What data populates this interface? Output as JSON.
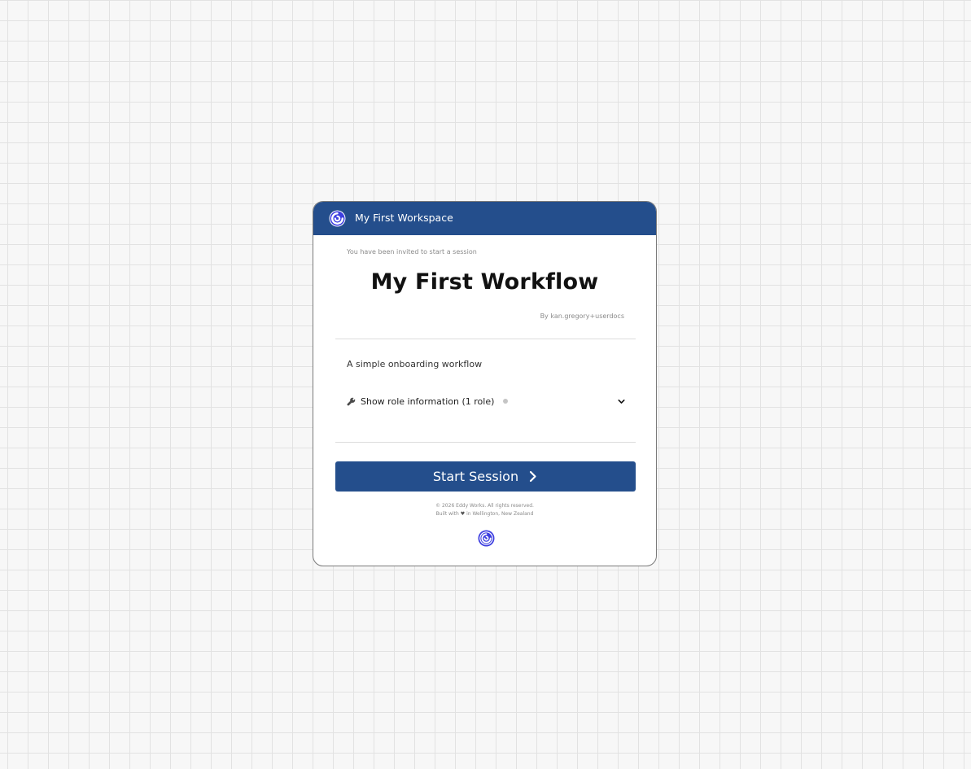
{
  "header": {
    "workspace_name": "My First Workspace",
    "logo_icon": "swirl-logo-icon"
  },
  "main": {
    "invite_text": "You have been invited to start a session",
    "title": "My First Workflow",
    "author": "By kan.gregory+userdocs",
    "description": "A simple onboarding workflow",
    "role_toggle_label": "Show role information (1 role)",
    "role_icon": "wrench-icon",
    "expand_icon": "chevron-down-icon"
  },
  "actions": {
    "start_label": "Start Session",
    "start_icon": "chevron-right-icon"
  },
  "footer": {
    "copyright": "© 2026 Eddy Works. All rights reserved.",
    "built_prefix": "Built with",
    "built_suffix": "in Wellington, New Zealand",
    "heart_glyph": "♥"
  },
  "colors": {
    "brand": "#244e8c",
    "logo_blue": "#3d3ee0",
    "background": "#f7f7f7",
    "grid": "#e2e2e2"
  }
}
